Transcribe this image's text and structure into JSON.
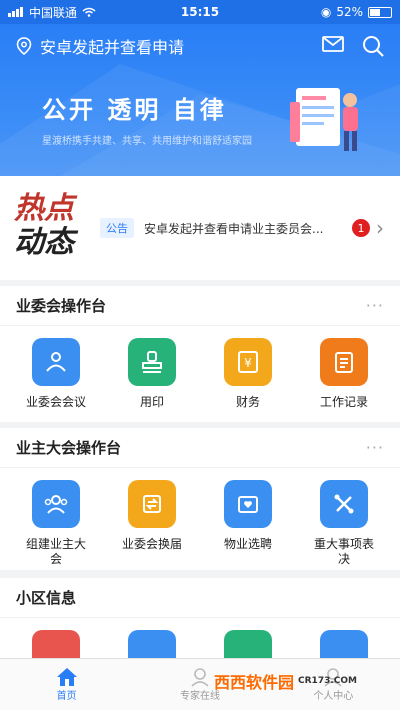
{
  "status": {
    "carrier": "中国联通",
    "time": "15:15",
    "battery": "52%",
    "battery_level": 0.52
  },
  "header": {
    "title": "安卓发起并查看申请"
  },
  "banner": {
    "title": "公开 透明 自律",
    "subtitle": "星渡桥携手共建、共享、共用维护和谐舒适家园"
  },
  "hot": {
    "logo_line1": "热点",
    "logo_line2": "动态",
    "tag": "公告",
    "notice": "安卓发起并查看申请业主委员会...",
    "badge": "1"
  },
  "sections": [
    {
      "title": "业委会操作台",
      "more": "···",
      "items": [
        {
          "label": "业委会会议",
          "color": "#3b8ff0"
        },
        {
          "label": "用印",
          "color": "#27b27a"
        },
        {
          "label": "财务",
          "color": "#f3a81c"
        },
        {
          "label": "工作记录",
          "color": "#f07b1a"
        }
      ]
    },
    {
      "title": "业主大会操作台",
      "more": "···",
      "items": [
        {
          "label": "组建业主大会",
          "color": "#3b8ff0"
        },
        {
          "label": "业委会换届",
          "color": "#f3a81c"
        },
        {
          "label": "物业选聘",
          "color": "#3b8ff0"
        },
        {
          "label": "重大事项表决",
          "color": "#3b8ff0"
        }
      ]
    },
    {
      "title": "小区信息",
      "items": [
        {
          "color": "#e8554e"
        },
        {
          "color": "#3b8ff0"
        },
        {
          "color": "#27b27a"
        },
        {
          "color": "#3b8ff0"
        }
      ]
    }
  ],
  "tabs": [
    {
      "label": "首页",
      "active": true
    },
    {
      "label": "专家在线",
      "active": false
    },
    {
      "label": "个人中心",
      "active": false
    }
  ],
  "watermark": {
    "brand": "西西软件园",
    "site": "CR173.COM"
  }
}
